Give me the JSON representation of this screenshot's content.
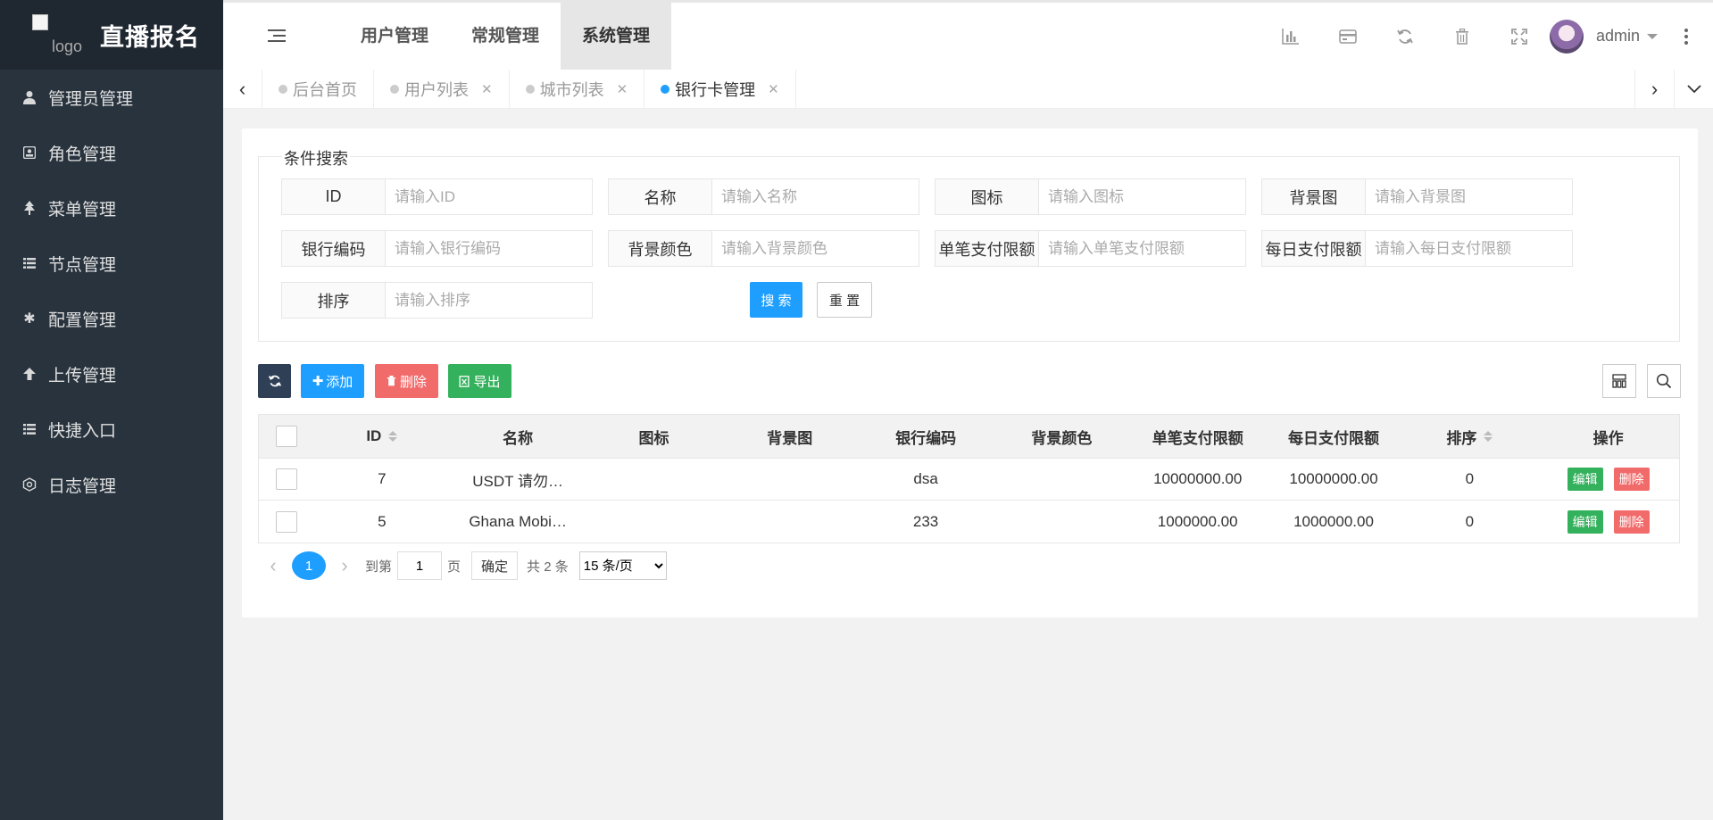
{
  "app": {
    "title": "直播报名",
    "logo_alt": "logo"
  },
  "sidebar": {
    "items": [
      {
        "label": "管理员管理",
        "icon": "user-icon"
      },
      {
        "label": "角色管理",
        "icon": "role-icon"
      },
      {
        "label": "菜单管理",
        "icon": "tree-icon"
      },
      {
        "label": "节点管理",
        "icon": "list-icon"
      },
      {
        "label": "配置管理",
        "icon": "asterisk-icon"
      },
      {
        "label": "上传管理",
        "icon": "arrow-up-icon"
      },
      {
        "label": "快捷入口",
        "icon": "list-icon"
      },
      {
        "label": "日志管理",
        "icon": "log-icon"
      }
    ]
  },
  "header": {
    "nav": [
      {
        "label": "用户管理",
        "active": false
      },
      {
        "label": "常规管理",
        "active": false
      },
      {
        "label": "系统管理",
        "active": true
      }
    ],
    "user_name": "admin"
  },
  "tabs": [
    {
      "label": "后台首页",
      "active": false,
      "closable": false
    },
    {
      "label": "用户列表",
      "active": false,
      "closable": true
    },
    {
      "label": "城市列表",
      "active": false,
      "closable": true
    },
    {
      "label": "银行卡管理",
      "active": true,
      "closable": true
    }
  ],
  "search": {
    "legend": "条件搜索",
    "fields": [
      {
        "label": "ID",
        "placeholder": "请输入ID"
      },
      {
        "label": "名称",
        "placeholder": "请输入名称"
      },
      {
        "label": "图标",
        "placeholder": "请输入图标"
      },
      {
        "label": "背景图",
        "placeholder": "请输入背景图"
      },
      {
        "label": "银行编码",
        "placeholder": "请输入银行编码"
      },
      {
        "label": "背景颜色",
        "placeholder": "请输入背景颜色"
      },
      {
        "label": "单笔支付限额",
        "placeholder": "请输入单笔支付限额"
      },
      {
        "label": "每日支付限额",
        "placeholder": "请输入每日支付限额"
      },
      {
        "label": "排序",
        "placeholder": "请输入排序"
      }
    ],
    "search_label": "搜 索",
    "reset_label": "重 置"
  },
  "toolbar": {
    "add_label": "添加",
    "delete_label": "删除",
    "export_label": "导出"
  },
  "table": {
    "columns": [
      "ID",
      "名称",
      "图标",
      "背景图",
      "银行编码",
      "背景颜色",
      "单笔支付限额",
      "每日支付限额",
      "排序",
      "操作"
    ],
    "rows": [
      {
        "id": "7",
        "name": "USDT 请勿…",
        "icon": "",
        "bg": "",
        "code": "dsa",
        "bgcolor": "",
        "single": "10000000.00",
        "daily": "10000000.00",
        "sort": "0"
      },
      {
        "id": "5",
        "name": "Ghana Mobi…",
        "icon": "",
        "bg": "",
        "code": "233",
        "bgcolor": "",
        "single": "1000000.00",
        "daily": "1000000.00",
        "sort": "0"
      }
    ],
    "edit_label": "编辑",
    "delete_label": "删除"
  },
  "pager": {
    "current": "1",
    "goto_label": "到第",
    "page_value": "1",
    "page_unit": "页",
    "confirm_label": "确定",
    "total_label": "共 2 条",
    "page_size": "15 条/页"
  },
  "colors": {
    "sidebar_bg": "#28333e",
    "primary": "#1e9fff",
    "success": "#34b15c",
    "danger": "#f26b6b"
  }
}
